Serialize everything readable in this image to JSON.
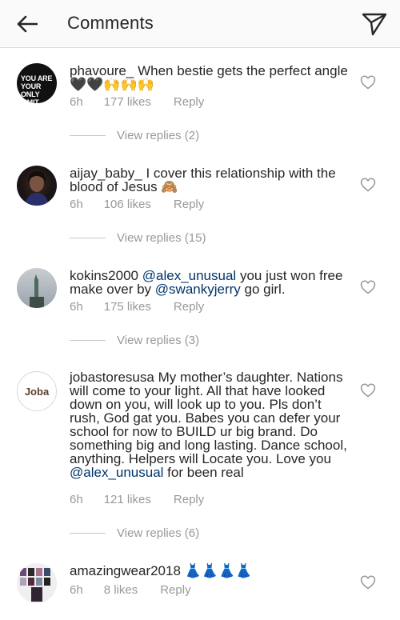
{
  "header": {
    "title": "Comments"
  },
  "comments": [
    {
      "username": "phavoure_",
      "text_parts": [
        "When bestie gets the perfect angle🖤🖤🙌🙌🙌"
      ],
      "time": "6h",
      "likes": "177 likes",
      "reply": "Reply",
      "avatar_text": "YOU ARE\nYOUR ONLY\nLIMIT.",
      "view_replies": "View replies (2)"
    },
    {
      "username": "aijay_baby_",
      "text_parts": [
        "I cover this relationship with the blood of Jesus 🙈"
      ],
      "time": "6h",
      "likes": "106 likes",
      "reply": "Reply",
      "view_replies": "View replies (15)"
    },
    {
      "username": "kokins2000",
      "mention1": "@alex_unusual",
      "text_mid": "you just won free make over by",
      "mention2": "@swankyjerry",
      "text_end": "go girl.",
      "time": "6h",
      "likes": "175 likes",
      "reply": "Reply",
      "view_replies": "View replies (3)"
    },
    {
      "username": "jobastoresusa",
      "text_start": "My mother’s daughter. Nations will come to your light. All that have looked down on you, will look up to you. Pls don’t rush, God gat you. Babes you can defer your school for now to BUILD ur big brand. Do something big and long lasting. Dance school, anything. Helpers will Locate you. Love you",
      "mention": "@alex_unusual",
      "text_end": " for been real",
      "avatar_text": "Joba",
      "time": "6h",
      "likes": "121 likes",
      "reply": "Reply",
      "view_replies": "View replies (6)"
    },
    {
      "username": "amazingwear2018",
      "text_parts": [
        "👗👗👗👗"
      ],
      "time": "6h",
      "likes": "8 likes",
      "reply": "Reply"
    }
  ]
}
